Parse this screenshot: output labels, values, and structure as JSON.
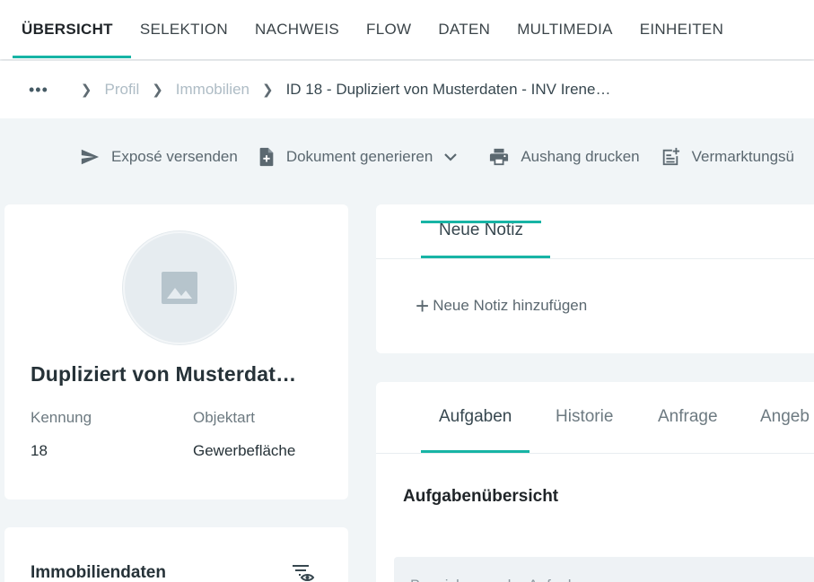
{
  "topnav": {
    "tabs": [
      {
        "label": "ÜBERSICHT"
      },
      {
        "label": "SELEKTION"
      },
      {
        "label": "NACHWEIS"
      },
      {
        "label": "FLOW"
      },
      {
        "label": "DATEN"
      },
      {
        "label": "MULTIMEDIA"
      },
      {
        "label": "EINHEITEN"
      }
    ],
    "active_tab": "ÜBERSICHT"
  },
  "breadcrumb": {
    "dots": "•••",
    "items": [
      "Profil",
      "Immobilien"
    ],
    "current": "ID 18 - Dupliziert von Musterdaten - INV Irene…"
  },
  "toolbar": {
    "actions": [
      {
        "label": "Exposé versenden",
        "icon": "send-icon"
      },
      {
        "label": "Dokument generieren",
        "icon": "document-add-icon"
      },
      {
        "label": "Aushang drucken",
        "icon": "printer-icon"
      },
      {
        "label": "Vermarktungsü",
        "icon": "post-add-icon"
      }
    ]
  },
  "profile": {
    "title": "Dupliziert von Musterdat…",
    "fields": [
      {
        "label": "Kennung",
        "value": "18"
      },
      {
        "label": "Objektart",
        "value": "Gewerbefläche"
      }
    ]
  },
  "property_data": {
    "title": "Immobiliendaten",
    "icon": "filter-visibility-icon"
  },
  "notes": {
    "tab_label": "Neue Notiz",
    "add_label": "Neue Notiz hinzufügen"
  },
  "tasks": {
    "tabs": [
      "Aufgaben",
      "Historie",
      "Anfrage",
      "Angeb"
    ],
    "active_tab": "Aufgaben",
    "heading": "Aufgabenübersicht",
    "input_placeholder": "Bezeichnung der Aufgabe"
  },
  "colors": {
    "accent": "#17b4a5",
    "page_background": "#f1f5f7",
    "muted_text": "#aebcc5"
  }
}
